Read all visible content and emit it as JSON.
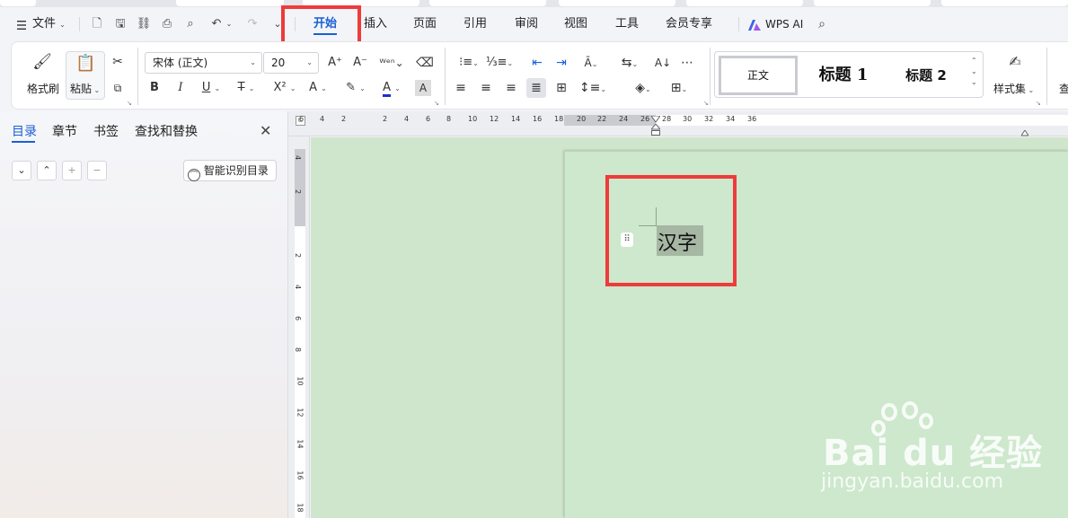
{
  "menubar": {
    "file_label": "文件",
    "tabs": [
      "开始",
      "插入",
      "页面",
      "引用",
      "审阅",
      "视图",
      "工具",
      "会员专享"
    ],
    "active_tab": "开始",
    "wps_ai_label": "WPS AI"
  },
  "ribbon": {
    "format_painter_label": "格式刷",
    "paste_label": "粘贴",
    "font_name": "宋体 (正文)",
    "font_size": "20",
    "styles": {
      "normal": "正文",
      "heading1": "标题 1",
      "heading2": "标题 2"
    },
    "style_set_label": "样式集",
    "find_label": "查"
  },
  "left_panel": {
    "tabs": [
      "目录",
      "章节",
      "书签",
      "查找和替换"
    ],
    "active_tab": "目录",
    "smart_toc_label": "智能识别目录"
  },
  "ruler": {
    "h_ticks": [
      "6",
      "4",
      "2",
      "2",
      "4",
      "6",
      "8",
      "10",
      "12",
      "14",
      "16",
      "18",
      "20",
      "22",
      "24",
      "26",
      "28",
      "30",
      "32",
      "34",
      "36"
    ],
    "v_ticks": [
      "4",
      "2",
      "2",
      "4",
      "6",
      "8",
      "10",
      "12",
      "14",
      "16",
      "18"
    ]
  },
  "document": {
    "text": "汉字"
  },
  "watermark": {
    "brand": "Bai du 经验",
    "url": "jingyan.baidu.com"
  },
  "colors": {
    "accent": "#1a5fd6",
    "highlight": "#ee3b3b",
    "doc_bg": "#cfe6cd",
    "selection": "#a6b8a4"
  }
}
